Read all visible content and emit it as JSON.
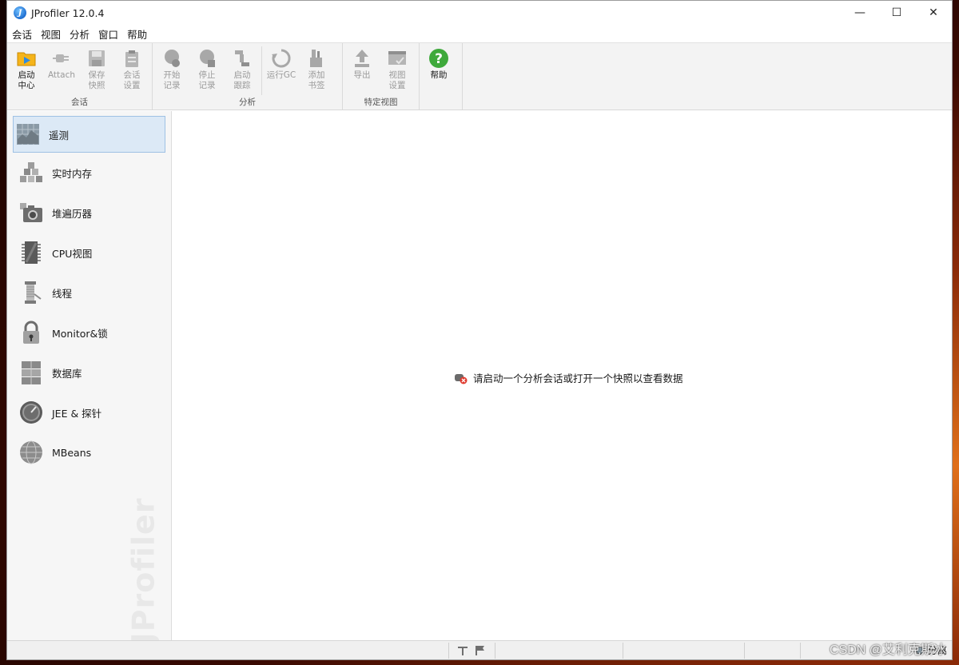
{
  "window": {
    "title": "JProfiler 12.0.4",
    "controls": {
      "minimize": "—",
      "maximize": "☐",
      "close": "✕"
    }
  },
  "menu": [
    "会话",
    "视图",
    "分析",
    "窗口",
    "帮助"
  ],
  "toolbar": {
    "groups": [
      {
        "label": "会话",
        "buttons": [
          {
            "label": "启动\n中心",
            "icon": "folder-play-icon",
            "enabled": true
          },
          {
            "label": "Attach",
            "icon": "plug-icon",
            "enabled": false
          },
          {
            "label": "保存\n快照",
            "icon": "save-icon",
            "enabled": false
          },
          {
            "label": "会话\n设置",
            "icon": "clipboard-settings-icon",
            "enabled": false
          }
        ]
      },
      {
        "label": "分析",
        "buttons": [
          {
            "label": "开始\n记录",
            "icon": "record-start-icon",
            "enabled": false
          },
          {
            "label": "停止\n记录",
            "icon": "record-stop-icon",
            "enabled": false
          },
          {
            "label": "启动\n跟踪",
            "icon": "tracking-icon",
            "enabled": false
          },
          {
            "label": "运行GC",
            "icon": "recycle-icon",
            "enabled": false
          },
          {
            "label": "添加\n书签",
            "icon": "bookmark-icon",
            "enabled": false
          }
        ]
      },
      {
        "label": "特定视图",
        "buttons": [
          {
            "label": "导出",
            "icon": "export-icon",
            "enabled": false
          },
          {
            "label": "视图\n设置",
            "icon": "view-settings-icon",
            "enabled": false
          }
        ]
      },
      {
        "label": "",
        "buttons": [
          {
            "label": "帮助",
            "icon": "help-icon",
            "enabled": true
          }
        ]
      }
    ]
  },
  "sidebar": {
    "items": [
      {
        "label": "遥测",
        "icon": "telemetry-icon",
        "active": true
      },
      {
        "label": "实时内存",
        "icon": "live-memory-icon",
        "active": false
      },
      {
        "label": "堆遍历器",
        "icon": "heap-walker-icon",
        "active": false
      },
      {
        "label": "CPU视图",
        "icon": "cpu-icon",
        "active": false
      },
      {
        "label": "线程",
        "icon": "threads-icon",
        "active": false
      },
      {
        "label": "Monitor&锁",
        "icon": "lock-icon",
        "active": false
      },
      {
        "label": "数据库",
        "icon": "database-icon",
        "active": false
      },
      {
        "label": "JEE & 探针",
        "icon": "probe-gauge-icon",
        "active": false
      },
      {
        "label": "MBeans",
        "icon": "globe-icon",
        "active": false
      }
    ],
    "watermark": "JProfiler"
  },
  "main": {
    "message": "请启动一个分析会话或打开一个快照以查看数据"
  },
  "statusbar": {
    "status_text": "分离"
  },
  "overlay": {
    "csdn": "CSDN @艾利克斯冰"
  }
}
